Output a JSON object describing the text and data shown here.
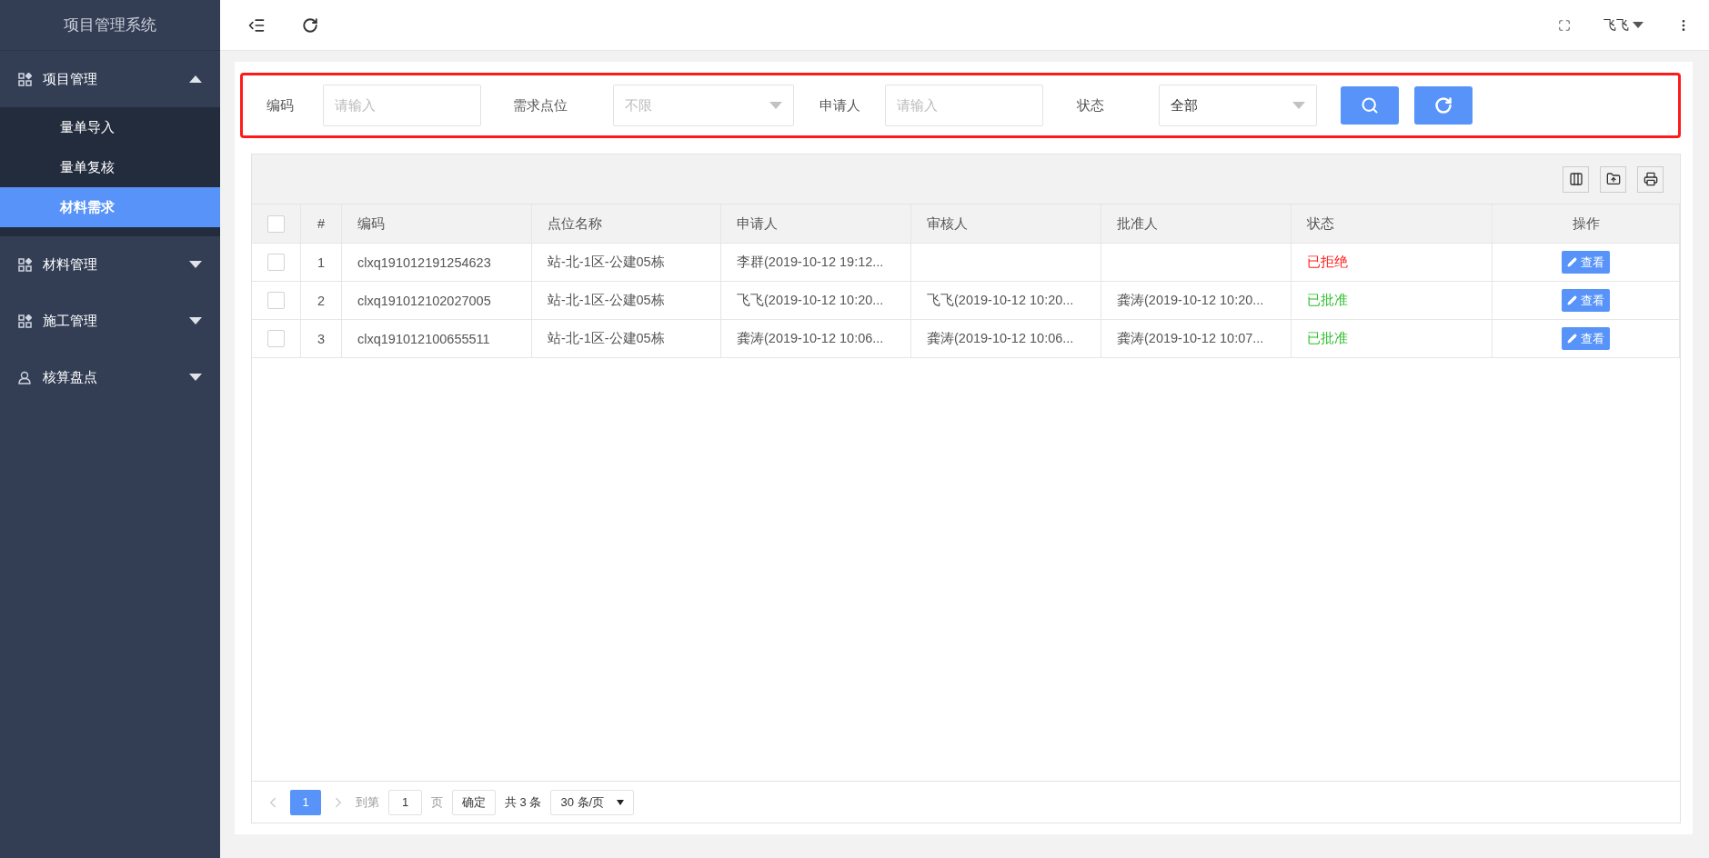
{
  "sidebar": {
    "title": "项目管理系统",
    "groups": [
      {
        "label": "项目管理",
        "kind": "grid",
        "expanded": true,
        "children": [
          {
            "label": "量单导入",
            "selected": false
          },
          {
            "label": "量单复核",
            "selected": false
          },
          {
            "label": "材料需求",
            "selected": true
          }
        ]
      },
      {
        "label": "材料管理",
        "kind": "grid",
        "expanded": false
      },
      {
        "label": "施工管理",
        "kind": "grid",
        "expanded": false
      },
      {
        "label": "核算盘点",
        "kind": "user",
        "expanded": false
      }
    ]
  },
  "topbar": {
    "user": "飞飞"
  },
  "filters": [
    {
      "kind": "input",
      "label": "编码",
      "placeholder": "请输入"
    },
    {
      "kind": "select",
      "label": "需求点位",
      "placeholder": "不限"
    },
    {
      "kind": "input",
      "label": "申请人",
      "placeholder": "请输入"
    },
    {
      "kind": "select",
      "label": "状态",
      "value": "全部"
    }
  ],
  "table": {
    "select_all_checked": false,
    "columns": [
      "#",
      "编码",
      "点位名称",
      "申请人",
      "审核人",
      "批准人",
      "状态",
      "操作"
    ],
    "rows": [
      {
        "checked": false,
        "index": "1",
        "code": "clxq191012191254623",
        "location": "站-北-1区-公建05栋",
        "applicant": "李群(2019-10-12 19:12...",
        "reviewer": "",
        "approver": "",
        "status": "已拒绝",
        "color": "#ff1a1a",
        "action": "查看"
      },
      {
        "checked": false,
        "index": "2",
        "code": "clxq191012102027005",
        "location": "站-北-1区-公建05栋",
        "applicant": "飞飞(2019-10-12 10:20...",
        "reviewer": "飞飞(2019-10-12 10:20...",
        "approver": "龚涛(2019-10-12 10:20...",
        "status": "已批准",
        "color": "#2fbf2f",
        "action": "查看"
      },
      {
        "checked": false,
        "index": "3",
        "code": "clxq191012100655511",
        "location": "站-北-1区-公建05栋",
        "applicant": "龚涛(2019-10-12 10:06...",
        "reviewer": "龚涛(2019-10-12 10:06...",
        "approver": "龚涛(2019-10-12 10:07...",
        "status": "已批准",
        "color": "#2fbf2f",
        "action": "查看"
      }
    ]
  },
  "pagination": {
    "pages": [
      {
        "label": "1",
        "selected": true
      }
    ],
    "goto_label": "到第",
    "goto_value": "1",
    "page_unit": "页",
    "confirm": "确定",
    "total": "共 3 条",
    "page_size": "30 条/页"
  }
}
